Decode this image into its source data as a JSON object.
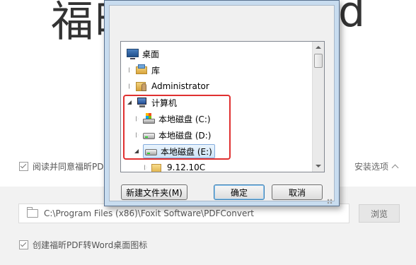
{
  "installer": {
    "title_left": "福昕",
    "title_right": "d",
    "agree_text": "阅读并同意福昕PDF",
    "install_options": "安装选项",
    "install_path": "C:\\Program Files (x86)\\Foxit Software\\PDFConvert",
    "browse_label": "浏览",
    "shortcut_text": "创建福昕PDF转Word桌面图标"
  },
  "dialog": {
    "tree": [
      {
        "label": "桌面",
        "icon": "desktop-icon"
      },
      {
        "label": "库",
        "icon": "library-icon"
      },
      {
        "label": "Administrator",
        "icon": "user-folder-icon"
      },
      {
        "label": "计算机",
        "icon": "computer-icon"
      },
      {
        "label": "本地磁盘 (C:)",
        "icon": "system-drive-icon"
      },
      {
        "label": "本地磁盘 (D:)",
        "icon": "drive-icon"
      },
      {
        "label": "本地磁盘 (E:)",
        "icon": "drive-icon",
        "selected": true
      },
      {
        "label": "9.12.10C",
        "icon": "folder-icon"
      }
    ],
    "new_folder_label": "新建文件夹(M)",
    "ok_label": "确定",
    "cancel_label": "取消"
  },
  "colors": {
    "highlight": "#e03030",
    "selection": "#cde4f8"
  }
}
